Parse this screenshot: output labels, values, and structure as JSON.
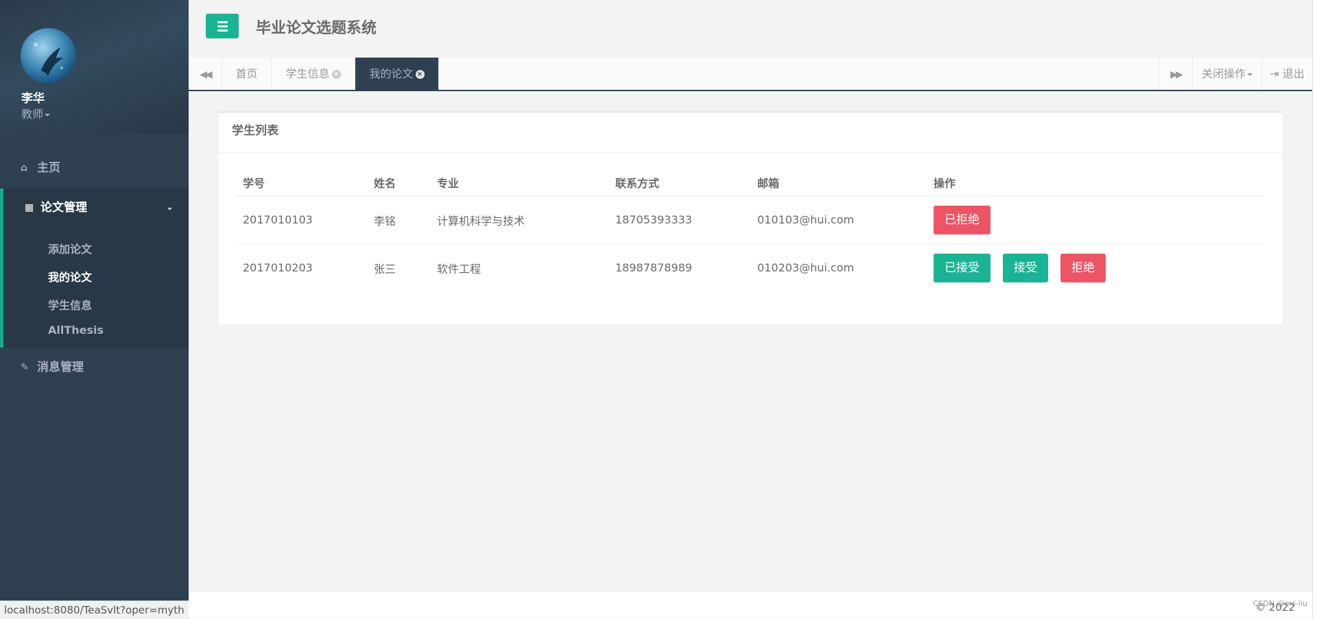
{
  "profile": {
    "name": "李华",
    "role": "教师"
  },
  "nav": {
    "home": "主页",
    "thesis_group": "论文管理",
    "sub_items": [
      "添加论文",
      "我的论文",
      "学生信息",
      "AllThesis"
    ],
    "messages": "消息管理"
  },
  "status_url": "localhost:8080/TeaSvlt?oper=myth",
  "header": {
    "title": "毕业论文选题系统"
  },
  "tabs": {
    "items": [
      "首页",
      "学生信息",
      "我的论文"
    ],
    "active": "我的论文",
    "close_ops": "关闭操作",
    "logout": "退出"
  },
  "panel": {
    "title": "学生列表",
    "columns": [
      "学号",
      "姓名",
      "专业",
      "联系方式",
      "邮箱",
      "操作"
    ],
    "rows": [
      {
        "id": "2017010103",
        "name": "李铭",
        "major": "计算机科学与技术",
        "phone": "18705393333",
        "email": "010103@hui.com",
        "actions": [
          "已拒绝"
        ]
      },
      {
        "id": "2017010203",
        "name": "张三",
        "major": "软件工程",
        "phone": "18987878989",
        "email": "010203@hui.com",
        "actions": [
          "已接受",
          "接受",
          "拒绝"
        ]
      }
    ]
  },
  "footer": {
    "copyright": "© 2022",
    "watermark": "CSDN @ms-liu"
  },
  "colors": {
    "sidebar": "#2f4050",
    "accent": "#1ab394",
    "danger": "#ed5565"
  },
  "icons": [
    "menu-icon",
    "home-icon",
    "table-icon",
    "chevron-down-icon",
    "edit-icon",
    "double-left-icon",
    "double-right-icon",
    "close-circle-icon",
    "logout-icon"
  ]
}
